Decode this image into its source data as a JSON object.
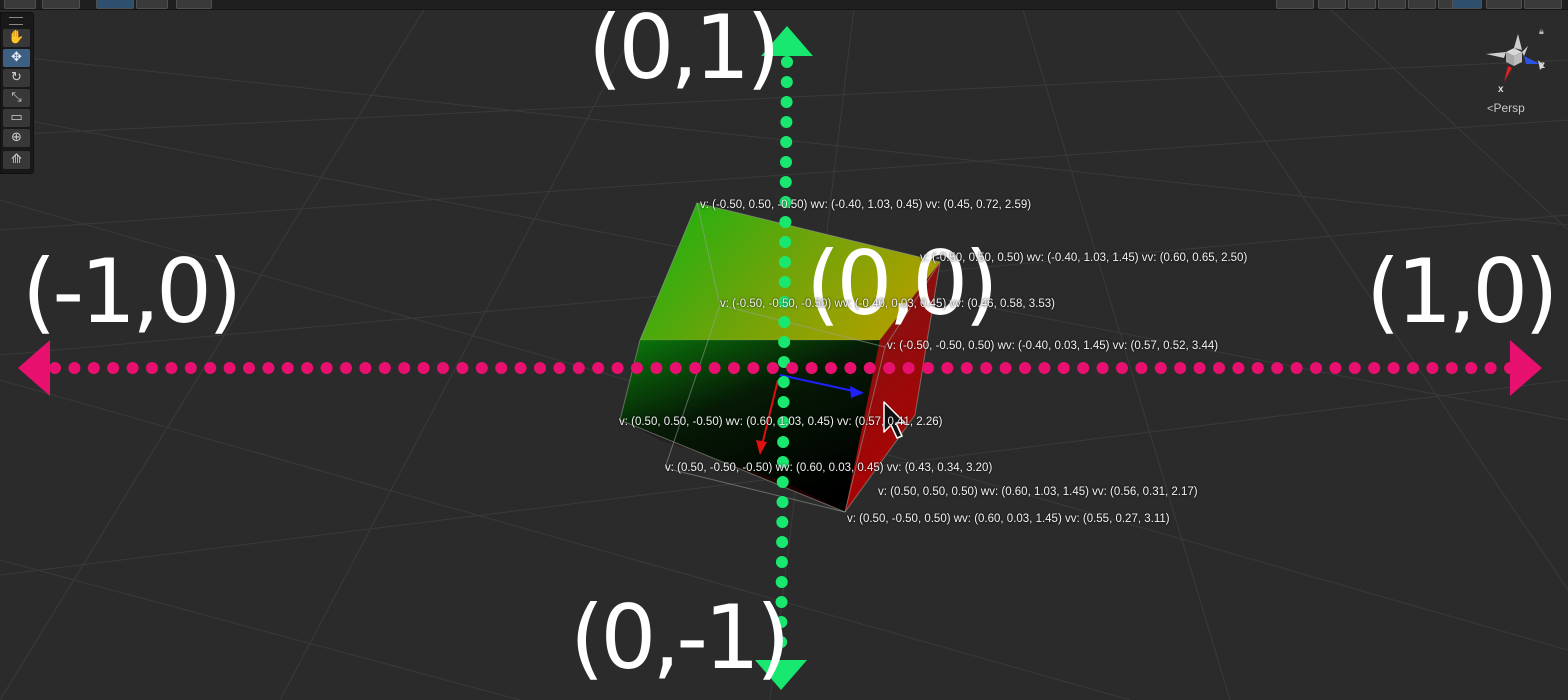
{
  "toolbar": {
    "tools": [
      {
        "name": "hand-tool",
        "icon": "hand-icon",
        "glyph": "✋",
        "active": false
      },
      {
        "name": "move-tool",
        "icon": "move-icon",
        "glyph": "✥",
        "active": true
      },
      {
        "name": "rotate-tool",
        "icon": "rotate-icon",
        "glyph": "↻",
        "active": false
      },
      {
        "name": "scale-tool",
        "icon": "scale-icon",
        "glyph": "⤡",
        "active": false
      },
      {
        "name": "rect-tool",
        "icon": "rect-icon",
        "glyph": "▭",
        "active": false
      },
      {
        "name": "transform-tool",
        "icon": "transform-icon",
        "glyph": "⊕",
        "active": false
      },
      {
        "name": "custom-tool",
        "icon": "custom-tool-icon",
        "glyph": "⟰",
        "active": false
      }
    ]
  },
  "gizmo": {
    "axis_x": "x",
    "axis_z": "z",
    "projection": "Persp"
  },
  "annotations": {
    "top": "(0,1)",
    "bottom": "(0,-1)",
    "left": "(-1,0)",
    "right": "(1,0)",
    "center": "(0,0)"
  },
  "vertex_labels": [
    "v: (-0.50, 0.50, -0.50) wv: (-0.40, 1.03, 0.45) vv: (0.45, 0.72, 2.59)",
    "v: (-0.50, 0.50, 0.50) wv: (-0.40, 1.03, 1.45) vv: (0.60, 0.65, 2.50)",
    "v: (-0.50, -0.50, -0.50) wv: (-0.40, 0.03, 0.45) vv: (0.46, 0.58, 3.53)",
    "v: (-0.50, -0.50, 0.50) wv: (-0.40, 0.03, 1.45) vv: (0.57, 0.52, 3.44)",
    "v: (0.50, 0.50, -0.50) wv: (0.60, 1.03, 0.45) vv: (0.57, 0.41, 2.26)",
    "v: (0.50, -0.50, -0.50) wv: (0.60, 0.03, 0.45) vv: (0.43, 0.34, 3.20)",
    "v: (0.50, 0.50, 0.50) wv: (0.60, 1.03, 1.45) vv: (0.56, 0.31, 2.17)",
    "v: (0.50, -0.50, 0.50) wv: (0.60, 0.03, 1.45) vv: (0.55, 0.27, 3.11)"
  ],
  "colors": {
    "background": "#2b2b2b",
    "grid": "#3a3a3a",
    "vertical_axis": "#19e870",
    "horizontal_axis": "#e8106e",
    "tool_active": "#3d5f82"
  }
}
